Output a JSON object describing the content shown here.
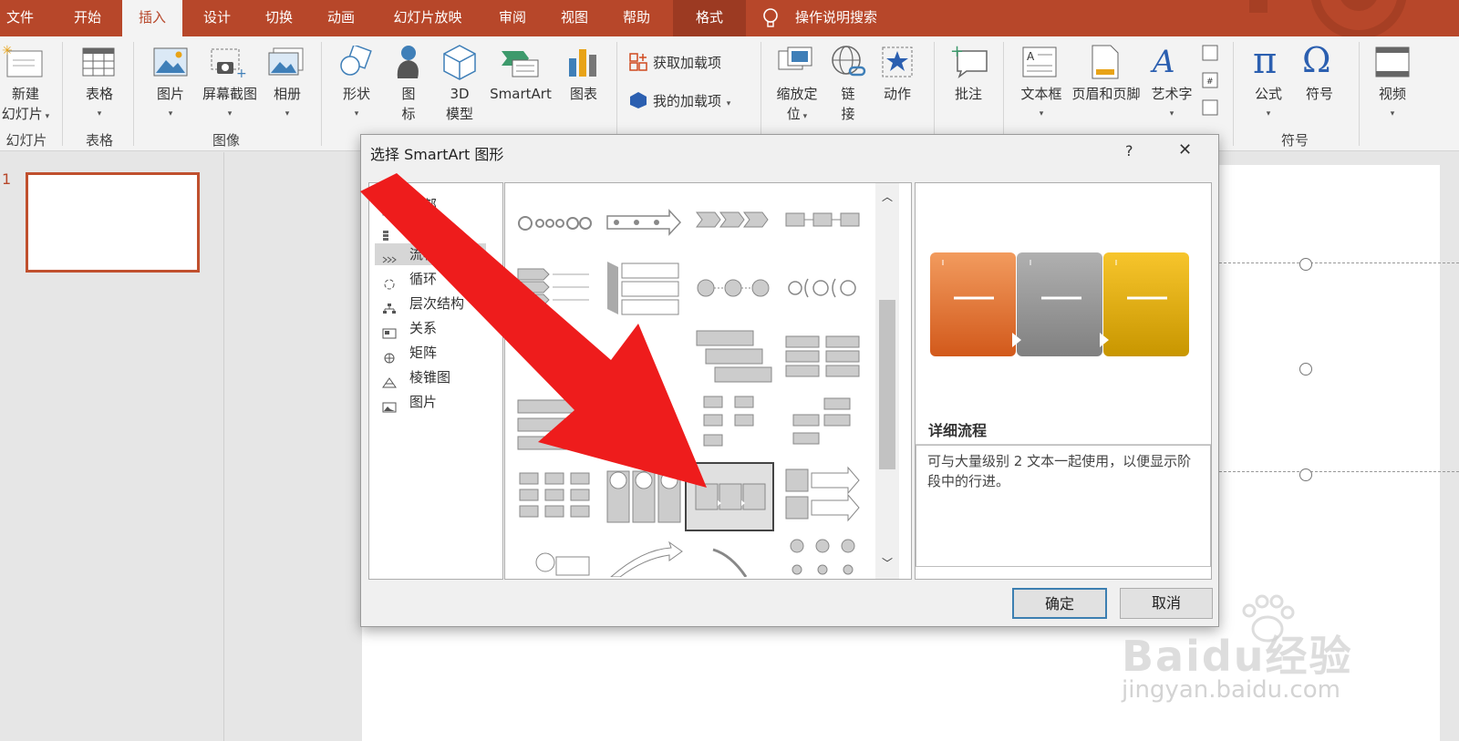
{
  "tabs": [
    {
      "label": "文件"
    },
    {
      "label": "开始"
    },
    {
      "label": "插入"
    },
    {
      "label": "设计"
    },
    {
      "label": "切换"
    },
    {
      "label": "动画"
    },
    {
      "label": "幻灯片放映"
    },
    {
      "label": "审阅"
    },
    {
      "label": "视图"
    },
    {
      "label": "帮助"
    },
    {
      "label": "格式"
    }
  ],
  "search": {
    "label": "操作说明搜索"
  },
  "ribbon": {
    "new_slide": [
      "新建",
      "幻灯片"
    ],
    "table": "表格",
    "picture": "图片",
    "screenshot": "屏幕截图",
    "album": "相册",
    "shapes": "形状",
    "icons": [
      "图",
      "标"
    ],
    "model3d": [
      "3D",
      "模型"
    ],
    "smartart": "SmartArt",
    "chart": "图表",
    "get_addins": "获取加载项",
    "my_addins": "我的加载项",
    "zoom": [
      "缩放定",
      "位"
    ],
    "link": [
      "链",
      "接"
    ],
    "action": "动作",
    "comment": "批注",
    "textbox": "文本框",
    "header_footer": "页眉和页脚",
    "wordart": "艺术字",
    "equation": "公式",
    "symbol": "符号",
    "video": "视频",
    "groups": {
      "slides": "幻灯片",
      "tables": "表格",
      "images": "图像",
      "symbols": "符号"
    }
  },
  "slide_number": "1",
  "dialog": {
    "title": "选择 SmartArt 图形",
    "help": "?",
    "close": "✕",
    "categories": [
      "全部",
      "列表",
      "流程",
      "循环",
      "层次结构",
      "关系",
      "矩阵",
      "棱锥图",
      "图片"
    ],
    "selected_category": "流程",
    "preview_title": "详细流程",
    "preview_desc": "可与大量级别 2 文本一起使用，以便显示阶段中的行进。",
    "ok": "确定",
    "cancel": "取消"
  },
  "watermark": {
    "brand": "Baidu经验",
    "url": "jingyan.baidu.com"
  },
  "colors": {
    "accent": "#b7472a",
    "arrow": "#ee1c1c",
    "orange": "#e06a1e",
    "gray": "#8c8c8c",
    "gold": "#d9a400"
  }
}
